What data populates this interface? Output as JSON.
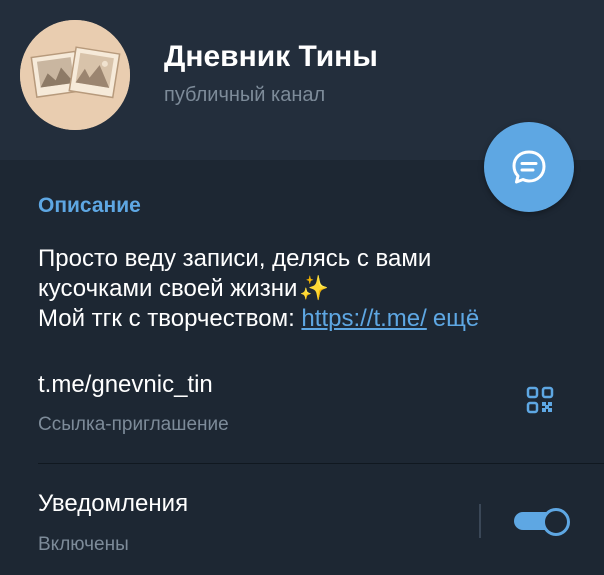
{
  "header": {
    "title": "Дневник Тины",
    "subtitle": "публичный канал",
    "avatar_icon": "photo-collage-avatar"
  },
  "fab": {
    "icon": "chat-bubble-icon"
  },
  "info": {
    "section_label": "Описание",
    "description": {
      "line1": "Просто веду записи, делясь с вами",
      "line2": "кусочками своей жизни",
      "sparkle": "✨",
      "line3_prefix": "Мой тгк с творчеством: ",
      "link_text": "https://t.me/",
      "more": "ещё"
    },
    "invite_link": "t.me/gnevnic_tin",
    "invite_caption": "Ссылка-приглашение",
    "qr_icon": "qr-code-icon"
  },
  "notifications": {
    "title": "Уведомления",
    "status": "Включены",
    "enabled": true
  },
  "colors": {
    "background": "#1d2733",
    "header": "#232e3c",
    "accent": "#5ea7e3",
    "muted": "#7d8b99"
  }
}
